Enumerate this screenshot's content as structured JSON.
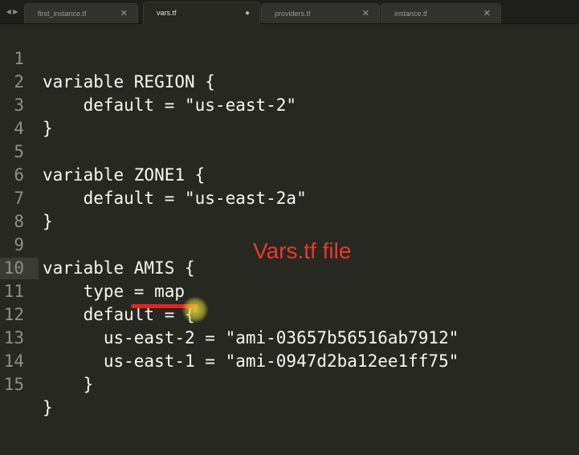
{
  "tabs": [
    {
      "label": "first_instance.tf",
      "close_icon": "close-icon",
      "active": false
    },
    {
      "label": "vars.tf",
      "close_icon": "unsaved-dot-icon",
      "active": true
    },
    {
      "label": "providers.tf",
      "close_icon": "close-icon",
      "active": false
    },
    {
      "label": "instance.tf",
      "close_icon": "close-icon",
      "active": false
    }
  ],
  "tab_glyphs": {
    "nav": "◀ ▶",
    "close": "✕",
    "unsaved": "●"
  },
  "editor": {
    "lines": [
      {
        "number": "1",
        "text": "variable REGION {"
      },
      {
        "number": "2",
        "text": "    default = \"us-east-2\""
      },
      {
        "number": "3",
        "text": "}"
      },
      {
        "number": "4",
        "text": ""
      },
      {
        "number": "5",
        "text": "variable ZONE1 {"
      },
      {
        "number": "6",
        "text": "    default = \"us-east-2a\""
      },
      {
        "number": "7",
        "text": "}"
      },
      {
        "number": "8",
        "text": ""
      },
      {
        "number": "9",
        "text": "variable AMIS {"
      },
      {
        "number": "10",
        "text": "    type = map"
      },
      {
        "number": "11",
        "text": "    default = {"
      },
      {
        "number": "12",
        "text": "      us-east-2 = \"ami-03657b56516ab7912\""
      },
      {
        "number": "13",
        "text": "      us-east-1 = \"ami-0947d2ba12ee1ff75\""
      },
      {
        "number": "14",
        "text": "    }"
      },
      {
        "number": "15",
        "text": "}"
      }
    ],
    "current_line": "11"
  },
  "annotation": {
    "text": "Vars.tf file"
  },
  "colors": {
    "background": "#272822",
    "tabbar": "#1e1f1c",
    "text": "#f8f8f2",
    "gutter_text": "#8f908a",
    "annotation": "#e83a2a",
    "highlight_marker": "#e8e23c"
  }
}
